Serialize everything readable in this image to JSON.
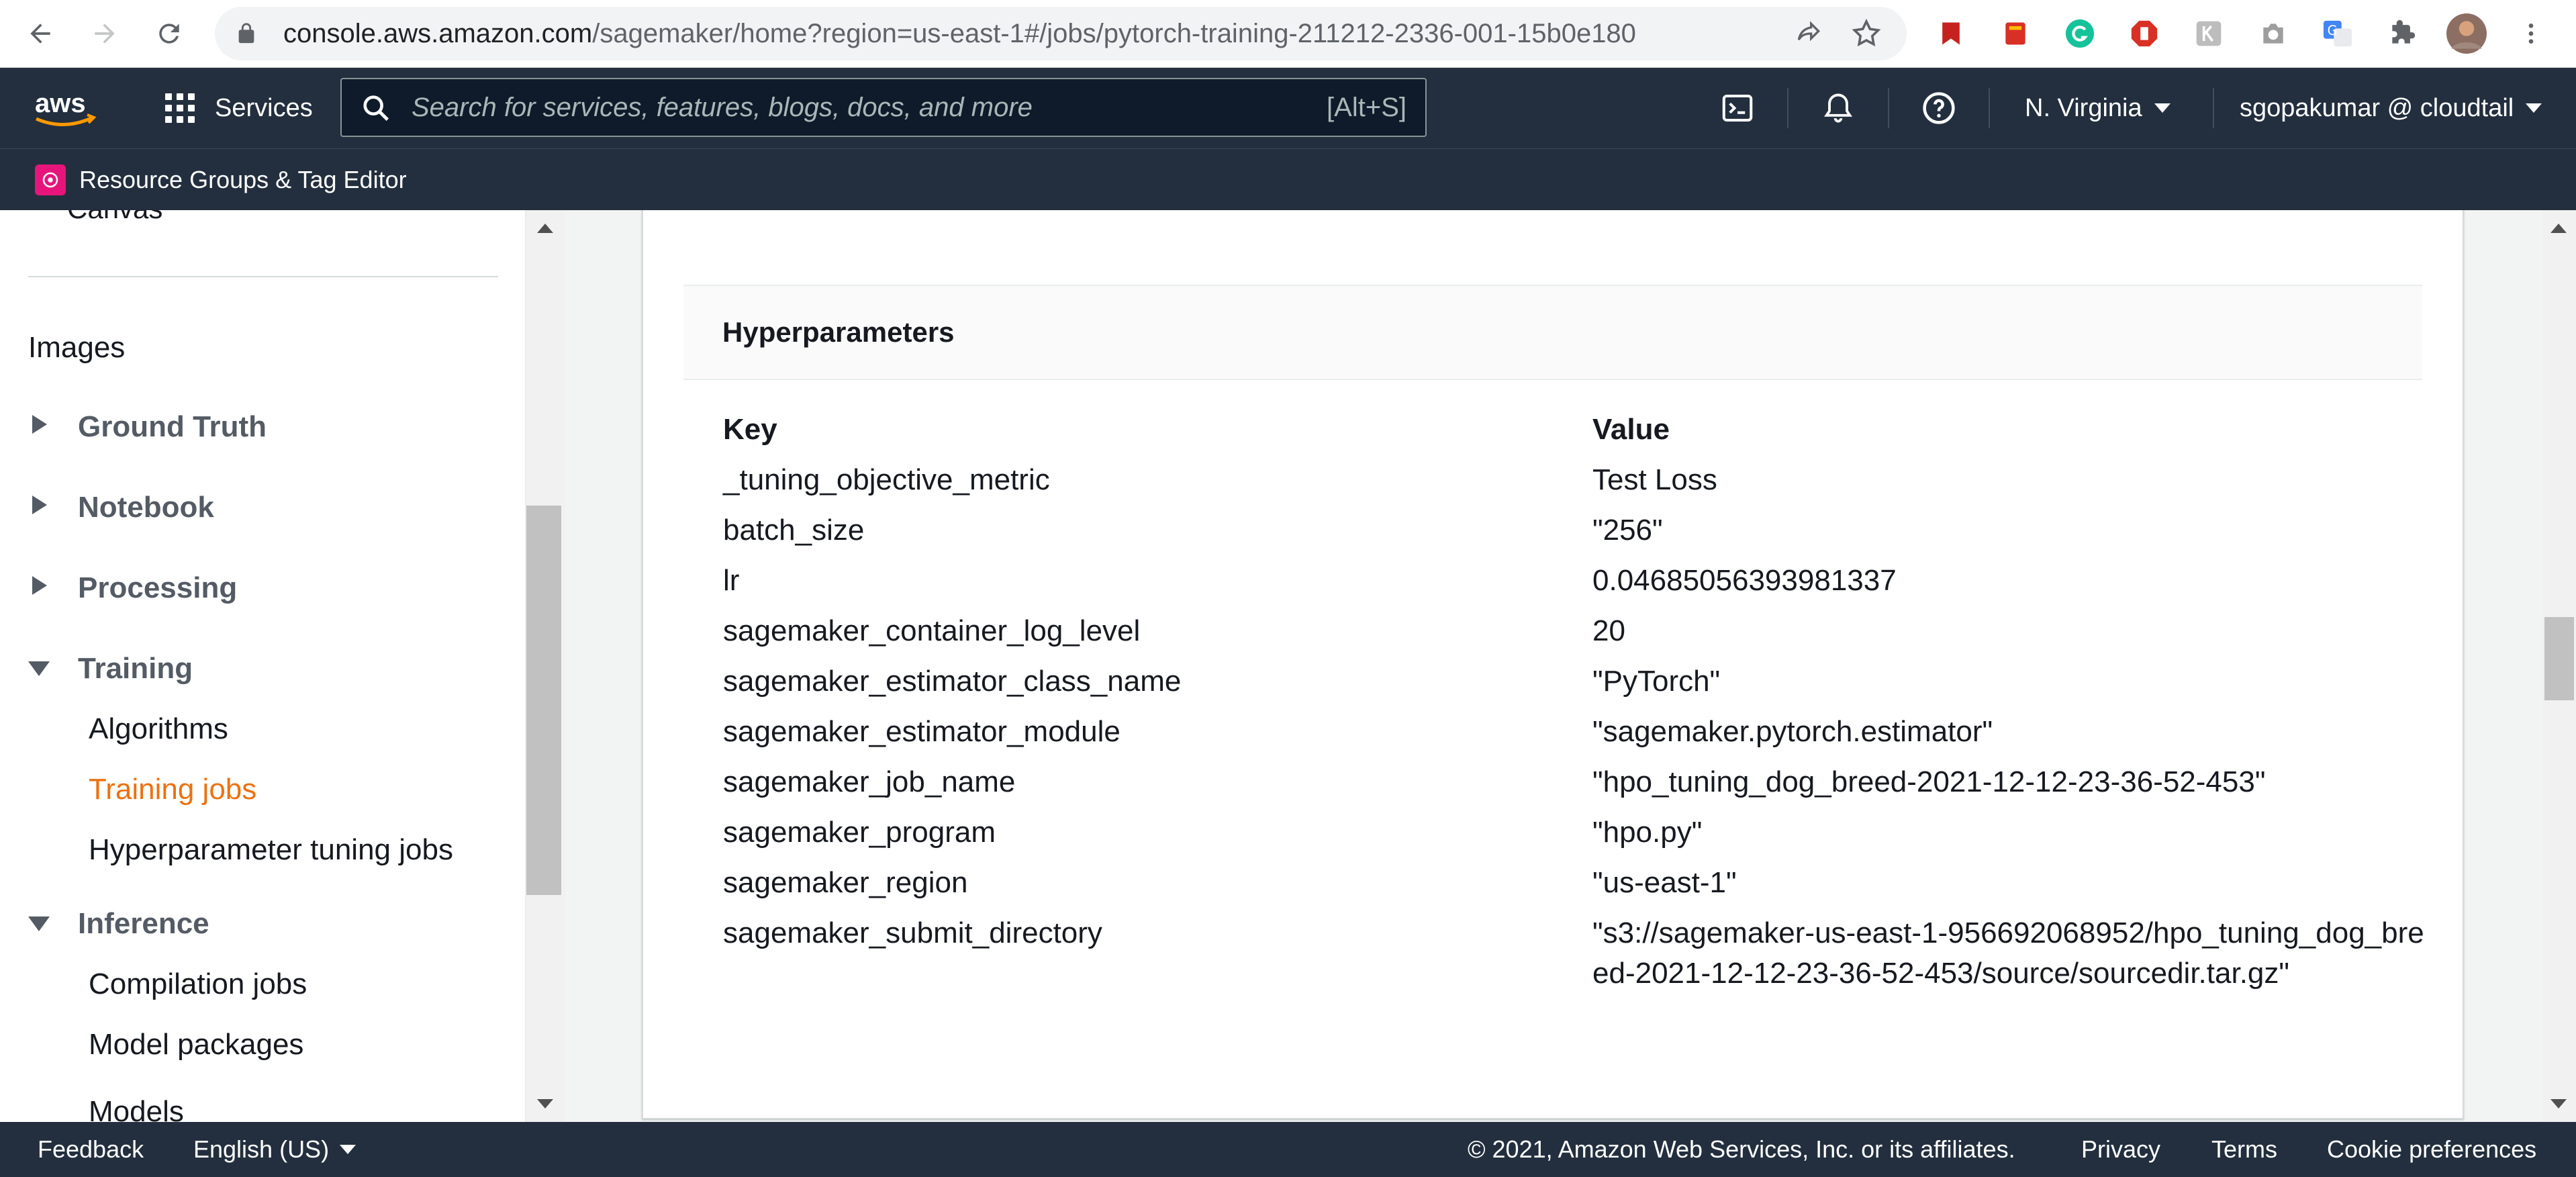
{
  "browser": {
    "url_host": "console.aws.amazon.com",
    "url_path": "/sagemaker/home?region=us-east-1#/jobs/pytorch-training-211212-2336-001-15b0e180",
    "icons": [
      "back-icon",
      "forward-icon",
      "reload-icon",
      "lock-icon",
      "share-icon",
      "star-icon",
      "extensions-icon",
      "menu-icon"
    ]
  },
  "aws_nav": {
    "services_label": "Services",
    "search_placeholder": "Search for services, features, blogs, docs, and more",
    "search_shortcut": "[Alt+S]",
    "region": "N. Virginia",
    "user": "sgopakumar @ cloudtail",
    "favorite": "Resource Groups & Tag Editor"
  },
  "sidebar": {
    "cut_item": "Canvas",
    "images": "Images",
    "ground_truth": "Ground Truth",
    "notebook": "Notebook",
    "processing": "Processing",
    "training": "Training",
    "algorithms": "Algorithms",
    "training_jobs": "Training jobs",
    "hpo_jobs": "Hyperparameter tuning jobs",
    "inference": "Inference",
    "compilation_jobs": "Compilation jobs",
    "model_packages": "Model packages",
    "models": "Models"
  },
  "hyperparameters": {
    "title": "Hyperparameters",
    "key_header": "Key",
    "value_header": "Value",
    "rows": [
      {
        "key": "_tuning_objective_metric",
        "value": "Test Loss"
      },
      {
        "key": "batch_size",
        "value": "\"256\""
      },
      {
        "key": "lr",
        "value": "0.04685056393981337"
      },
      {
        "key": "sagemaker_container_log_level",
        "value": "20"
      },
      {
        "key": "sagemaker_estimator_class_name",
        "value": "\"PyTorch\""
      },
      {
        "key": "sagemaker_estimator_module",
        "value": "\"sagemaker.pytorch.estimator\""
      },
      {
        "key": "sagemaker_job_name",
        "value": "\"hpo_tuning_dog_breed-2021-12-12-23-36-52-453\""
      },
      {
        "key": "sagemaker_program",
        "value": "\"hpo.py\""
      },
      {
        "key": "sagemaker_region",
        "value": "\"us-east-1\""
      },
      {
        "key": "sagemaker_submit_directory",
        "value": "\"s3://sagemaker-us-east-1-956692068952/hpo_tuning_dog_breed-2021-12-12-23-36-52-453/source/sourcedir.tar.gz\""
      }
    ]
  },
  "footer": {
    "feedback": "Feedback",
    "language": "English (US)",
    "copyright": "© 2021, Amazon Web Services, Inc. or its affiliates.",
    "privacy": "Privacy",
    "terms": "Terms",
    "cookies": "Cookie preferences"
  },
  "colors": {
    "nav_bg": "#232f3e",
    "active_link": "#ec7211",
    "aws_orange": "#ff9900"
  }
}
